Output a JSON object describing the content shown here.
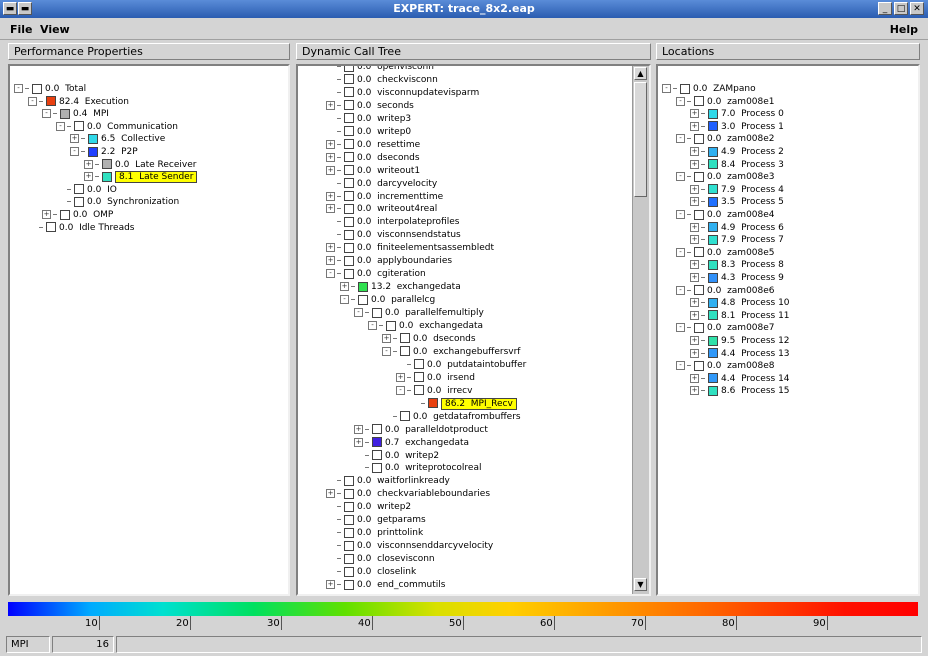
{
  "window": {
    "title": "EXPERT: trace_8x2.eap"
  },
  "menu": {
    "file": "File",
    "view": "View",
    "help": "Help"
  },
  "panes": {
    "left_title": "Performance Properties",
    "middle_title": "Dynamic Call Tree",
    "right_title": "Locations"
  },
  "colors": {
    "red": "#e84010",
    "gray": "#b0b0b0",
    "cyan": "#30e0e0",
    "blue": "#2040ff",
    "green": "#30e050",
    "teal": "#30e0b0",
    "purple": "#4020e0",
    "highlight": "#ffff00"
  },
  "left_tree": [
    {
      "value": "0.0",
      "label": "Total",
      "expander": "-",
      "color": "#ffffff"
    },
    {
      "value": "82.4",
      "label": "Execution",
      "expander": "-",
      "color": "#e84010"
    },
    {
      "value": "0.4",
      "label": "MPI",
      "expander": "-",
      "color": "#b0b0b0"
    },
    {
      "value": "0.0",
      "label": "Communication",
      "expander": "-",
      "color": "#ffffff"
    },
    {
      "value": "6.5",
      "label": "Collective",
      "expander": "+",
      "color": "#30d8e8"
    },
    {
      "value": "2.2",
      "label": "P2P",
      "expander": "-",
      "color": "#2040ff"
    },
    {
      "value": "0.0",
      "label": "Late Receiver",
      "expander": "+",
      "color": "#b0b0b0"
    },
    {
      "value": "8.1",
      "label": "Late Sender",
      "expander": "+",
      "color": "#30e0c0",
      "highlight": true
    },
    {
      "value": "0.0",
      "label": "IO",
      "expander": "",
      "color": "#ffffff"
    },
    {
      "value": "0.0",
      "label": "Synchronization",
      "expander": "",
      "color": "#ffffff"
    },
    {
      "value": "0.0",
      "label": "OMP",
      "expander": "+",
      "color": "#ffffff"
    },
    {
      "value": "0.0",
      "label": "Idle Threads",
      "expander": "",
      "color": "#ffffff"
    }
  ],
  "call_tree": [
    {
      "value": "0.0",
      "label": "openvisconn",
      "expander": "",
      "color": "#ffffff"
    },
    {
      "value": "0.0",
      "label": "checkvisconn",
      "expander": "",
      "color": "#ffffff"
    },
    {
      "value": "0.0",
      "label": "visconnupdatevisparm",
      "expander": "",
      "color": "#ffffff"
    },
    {
      "value": "0.0",
      "label": "seconds",
      "expander": "+",
      "color": "#ffffff"
    },
    {
      "value": "0.0",
      "label": "writep3",
      "expander": "",
      "color": "#ffffff"
    },
    {
      "value": "0.0",
      "label": "writep0",
      "expander": "",
      "color": "#ffffff"
    },
    {
      "value": "0.0",
      "label": "resettime",
      "expander": "+",
      "color": "#ffffff"
    },
    {
      "value": "0.0",
      "label": "dseconds",
      "expander": "+",
      "color": "#ffffff"
    },
    {
      "value": "0.0",
      "label": "writeout1",
      "expander": "+",
      "color": "#ffffff"
    },
    {
      "value": "0.0",
      "label": "darcyvelocity",
      "expander": "",
      "color": "#ffffff"
    },
    {
      "value": "0.0",
      "label": "incrementtime",
      "expander": "+",
      "color": "#ffffff"
    },
    {
      "value": "0.0",
      "label": "writeout4real",
      "expander": "+",
      "color": "#ffffff"
    },
    {
      "value": "0.0",
      "label": "interpolateprofiles",
      "expander": "",
      "color": "#ffffff"
    },
    {
      "value": "0.0",
      "label": "visconnsendstatus",
      "expander": "",
      "color": "#ffffff"
    },
    {
      "value": "0.0",
      "label": "finiteelementsassembledt",
      "expander": "+",
      "color": "#ffffff"
    },
    {
      "value": "0.0",
      "label": "applyboundaries",
      "expander": "+",
      "color": "#ffffff"
    },
    {
      "value": "0.0",
      "label": "cgiteration",
      "expander": "-",
      "color": "#ffffff"
    },
    {
      "value": "13.2",
      "label": "exchangedata",
      "expander": "+",
      "color": "#30e050"
    },
    {
      "value": "0.0",
      "label": "parallelcg",
      "expander": "-",
      "color": "#ffffff"
    },
    {
      "value": "0.0",
      "label": "parallelfemultiply",
      "expander": "-",
      "color": "#ffffff"
    },
    {
      "value": "0.0",
      "label": "exchangedata",
      "expander": "-",
      "color": "#ffffff"
    },
    {
      "value": "0.0",
      "label": "dseconds",
      "expander": "+",
      "color": "#ffffff"
    },
    {
      "value": "0.0",
      "label": "exchangebuffersvrf",
      "expander": "-",
      "color": "#ffffff"
    },
    {
      "value": "0.0",
      "label": "putdataintobuffer",
      "expander": "",
      "color": "#ffffff"
    },
    {
      "value": "0.0",
      "label": "irsend",
      "expander": "+",
      "color": "#ffffff"
    },
    {
      "value": "0.0",
      "label": "irrecv",
      "expander": "-",
      "color": "#ffffff"
    },
    {
      "value": "86.2",
      "label": "MPI_Recv",
      "expander": "",
      "color": "#e84010",
      "highlight": true
    },
    {
      "value": "0.0",
      "label": "getdatafrombuffers",
      "expander": "",
      "color": "#ffffff"
    },
    {
      "value": "0.0",
      "label": "paralleldotproduct",
      "expander": "+",
      "color": "#ffffff"
    },
    {
      "value": "0.7",
      "label": "exchangedata",
      "expander": "+",
      "color": "#4020e0"
    },
    {
      "value": "0.0",
      "label": "writep2",
      "expander": "",
      "color": "#ffffff"
    },
    {
      "value": "0.0",
      "label": "writeprotocolreal",
      "expander": "",
      "color": "#ffffff"
    },
    {
      "value": "0.0",
      "label": "waitforlinkready",
      "expander": "",
      "color": "#ffffff"
    },
    {
      "value": "0.0",
      "label": "checkvariableboundaries",
      "expander": "+",
      "color": "#ffffff"
    },
    {
      "value": "0.0",
      "label": "writep2",
      "expander": "",
      "color": "#ffffff"
    },
    {
      "value": "0.0",
      "label": "getparams",
      "expander": "",
      "color": "#ffffff"
    },
    {
      "value": "0.0",
      "label": "printtolink",
      "expander": "",
      "color": "#ffffff"
    },
    {
      "value": "0.0",
      "label": "visconnsenddarcyvelocity",
      "expander": "",
      "color": "#ffffff"
    },
    {
      "value": "0.0",
      "label": "closevisconn",
      "expander": "",
      "color": "#ffffff"
    },
    {
      "value": "0.0",
      "label": "closelink",
      "expander": "",
      "color": "#ffffff"
    },
    {
      "value": "0.0",
      "label": "end_commutils",
      "expander": "+",
      "color": "#ffffff"
    }
  ],
  "locations": [
    {
      "value": "0.0",
      "label": "ZAMpano",
      "expander": "-",
      "color": "#ffffff"
    },
    {
      "value": "0.0",
      "label": "zam008e1",
      "expander": "-",
      "color": "#ffffff"
    },
    {
      "value": "7.0",
      "label": "Process 0",
      "expander": "+",
      "color": "#30d8e8"
    },
    {
      "value": "3.0",
      "label": "Process 1",
      "expander": "+",
      "color": "#2060ff"
    },
    {
      "value": "0.0",
      "label": "zam008e2",
      "expander": "-",
      "color": "#ffffff"
    },
    {
      "value": "4.9",
      "label": "Process 2",
      "expander": "+",
      "color": "#30b0f0"
    },
    {
      "value": "8.4",
      "label": "Process 3",
      "expander": "+",
      "color": "#30e0c0"
    },
    {
      "value": "0.0",
      "label": "zam008e3",
      "expander": "-",
      "color": "#ffffff"
    },
    {
      "value": "7.9",
      "label": "Process 4",
      "expander": "+",
      "color": "#30e0d0"
    },
    {
      "value": "3.5",
      "label": "Process 5",
      "expander": "+",
      "color": "#2070ff"
    },
    {
      "value": "0.0",
      "label": "zam008e4",
      "expander": "-",
      "color": "#ffffff"
    },
    {
      "value": "4.9",
      "label": "Process 6",
      "expander": "+",
      "color": "#30b0f0"
    },
    {
      "value": "7.9",
      "label": "Process 7",
      "expander": "+",
      "color": "#30e0d0"
    },
    {
      "value": "0.0",
      "label": "zam008e5",
      "expander": "-",
      "color": "#ffffff"
    },
    {
      "value": "8.3",
      "label": "Process 8",
      "expander": "+",
      "color": "#30e0c0"
    },
    {
      "value": "4.3",
      "label": "Process 9",
      "expander": "+",
      "color": "#3090f8"
    },
    {
      "value": "0.0",
      "label": "zam008e6",
      "expander": "-",
      "color": "#ffffff"
    },
    {
      "value": "4.8",
      "label": "Process 10",
      "expander": "+",
      "color": "#30b0f0"
    },
    {
      "value": "8.1",
      "label": "Process 11",
      "expander": "+",
      "color": "#30e0c0"
    },
    {
      "value": "0.0",
      "label": "zam008e7",
      "expander": "-",
      "color": "#ffffff"
    },
    {
      "value": "9.5",
      "label": "Process 12",
      "expander": "+",
      "color": "#30e0a8"
    },
    {
      "value": "4.4",
      "label": "Process 13",
      "expander": "+",
      "color": "#3098f8"
    },
    {
      "value": "0.0",
      "label": "zam008e8",
      "expander": "-",
      "color": "#ffffff"
    },
    {
      "value": "4.4",
      "label": "Process 14",
      "expander": "+",
      "color": "#3098f8"
    },
    {
      "value": "8.6",
      "label": "Process 15",
      "expander": "+",
      "color": "#30e0c0"
    }
  ],
  "colorbar": {
    "ticks": [
      "10",
      "20",
      "30",
      "40",
      "50",
      "60",
      "70",
      "80",
      "90"
    ]
  },
  "status": {
    "metric": "MPI",
    "value": "16"
  }
}
